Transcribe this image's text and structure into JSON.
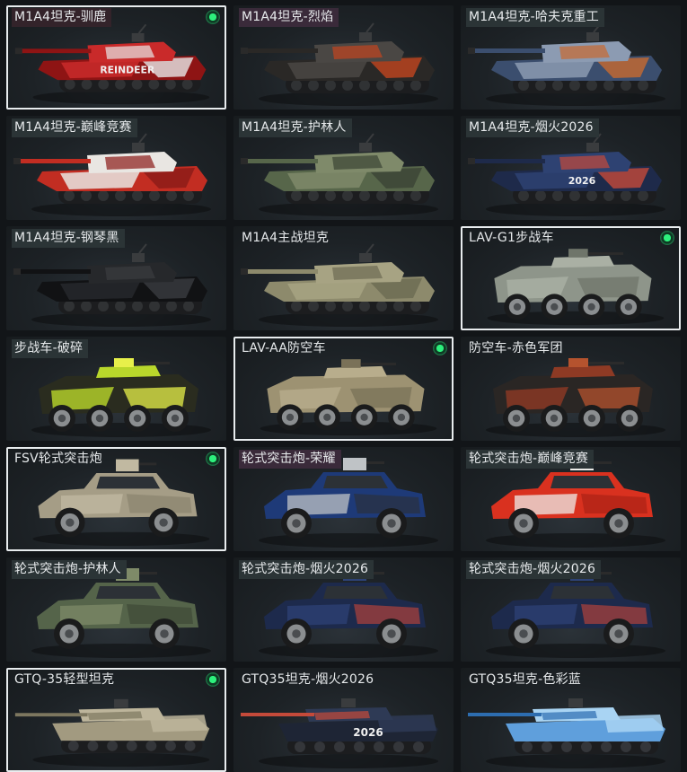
{
  "items": [
    {
      "name": "M1A4坦克-驯鹿",
      "selected": true,
      "equipped": true,
      "type": "tank",
      "colors": [
        "#8e1414",
        "#c92a2a",
        "#e7e7e7"
      ],
      "label_bg": "#33232a",
      "decal": "REINDEER"
    },
    {
      "name": "M1A4坦克-烈焰",
      "selected": false,
      "equipped": false,
      "type": "tank",
      "colors": [
        "#2a2826",
        "#4a4744",
        "#c2451f"
      ],
      "label_bg": "#3a2a3a",
      "decal": ""
    },
    {
      "name": "M1A4坦克-哈夫克重工",
      "selected": false,
      "equipped": false,
      "type": "tank",
      "colors": [
        "#3b4e6e",
        "#8c9bb2",
        "#c86a30"
      ],
      "label_bg": "#2b3436",
      "decal": ""
    },
    {
      "name": "M1A4坦克-巅峰竞赛",
      "selected": false,
      "equipped": false,
      "type": "tank",
      "colors": [
        "#c22d22",
        "#e9e6e2",
        "#8a1a18"
      ],
      "label_bg": "#2b3436",
      "decal": ""
    },
    {
      "name": "M1A4坦克-护林人",
      "selected": false,
      "equipped": false,
      "type": "tank",
      "colors": [
        "#57664a",
        "#7f8a6a",
        "#3b4434"
      ],
      "label_bg": "#2b3436",
      "decal": ""
    },
    {
      "name": "M1A4坦克-烟火2026",
      "selected": false,
      "equipped": false,
      "type": "tank",
      "colors": [
        "#1e2a4a",
        "#2e4272",
        "#c44a3a"
      ],
      "label_bg": "#2b3436",
      "decal": "2026"
    },
    {
      "name": "M1A4坦克-钢琴黑",
      "selected": false,
      "equipped": false,
      "type": "tank",
      "colors": [
        "#111214",
        "#26282b",
        "#3a3c40"
      ],
      "label_bg": "#2b3436",
      "decal": ""
    },
    {
      "name": "M1A4主战坦克",
      "selected": false,
      "equipped": false,
      "type": "tank",
      "colors": [
        "#8d8a6c",
        "#a7a383",
        "#6c6a52"
      ],
      "label_bg": "",
      "decal": ""
    },
    {
      "name": "LAV-G1步战车",
      "selected": true,
      "equipped": true,
      "type": "apc",
      "colors": [
        "#8e958a",
        "#aab0a4",
        "#6f756a"
      ],
      "label_bg": "",
      "decal": ""
    },
    {
      "name": "步战车-破碎",
      "selected": false,
      "equipped": false,
      "type": "apc",
      "colors": [
        "#2a2c1f",
        "#b9d72b",
        "#e7f04a"
      ],
      "label_bg": "#2b3436",
      "decal": ""
    },
    {
      "name": "LAV-AA防空车",
      "selected": true,
      "equipped": true,
      "type": "apc",
      "colors": [
        "#9d9272",
        "#b8ad8c",
        "#7a7158"
      ],
      "label_bg": "",
      "decal": ""
    },
    {
      "name": "防空车-赤色军团",
      "selected": false,
      "equipped": false,
      "type": "apc",
      "colors": [
        "#2a2624",
        "#8e3a24",
        "#b5532e"
      ],
      "label_bg": "",
      "decal": ""
    },
    {
      "name": "FSV轮式突击炮",
      "selected": true,
      "equipped": true,
      "type": "mrap",
      "colors": [
        "#a59d86",
        "#c1b9a1",
        "#857e6a"
      ],
      "label_bg": "",
      "decal": ""
    },
    {
      "name": "轮式突击炮-荣耀",
      "selected": false,
      "equipped": false,
      "type": "mrap",
      "colors": [
        "#1e3a78",
        "#bfc3c6",
        "#2b2e33"
      ],
      "label_bg": "#3a2a3a",
      "decal": ""
    },
    {
      "name": "轮式突击炮-巅峰竞赛",
      "selected": false,
      "equipped": false,
      "type": "mrap",
      "colors": [
        "#d9311f",
        "#ecebe8",
        "#a41f14"
      ],
      "label_bg": "#2b3436",
      "decal": ""
    },
    {
      "name": "轮式突击炮-护林人",
      "selected": false,
      "equipped": false,
      "type": "mrap",
      "colors": [
        "#55644a",
        "#7e8a68",
        "#3a4434"
      ],
      "label_bg": "#2b3436",
      "decal": ""
    },
    {
      "name": "轮式突击炮-烟火2026",
      "selected": false,
      "equipped": false,
      "type": "mrap",
      "colors": [
        "#1d2a4c",
        "#2d4276",
        "#c84638"
      ],
      "label_bg": "#2b3436",
      "decal": ""
    },
    {
      "name": "轮式突击炮-烟火2026",
      "selected": false,
      "equipped": false,
      "type": "mrap",
      "colors": [
        "#1d2a4c",
        "#2d4276",
        "#c84638"
      ],
      "label_bg": "#2b3436",
      "decal": ""
    },
    {
      "name": "GTQ-35轻型坦克",
      "selected": true,
      "equipped": true,
      "type": "ltank",
      "colors": [
        "#a29a80",
        "#bdb59b",
        "#7d775f"
      ],
      "label_bg": "",
      "decal": ""
    },
    {
      "name": "GTQ35坦克-烟火2026",
      "selected": false,
      "equipped": false,
      "type": "ltank",
      "colors": [
        "#1e2535",
        "#2e3a55",
        "#c44a3a"
      ],
      "label_bg": "",
      "decal": "2026"
    },
    {
      "name": "GTQ35坦克-色彩蓝",
      "selected": false,
      "equipped": false,
      "type": "ltank",
      "colors": [
        "#5f9fdc",
        "#a9d4f3",
        "#2d6db0"
      ],
      "label_bg": "",
      "decal": ""
    }
  ]
}
